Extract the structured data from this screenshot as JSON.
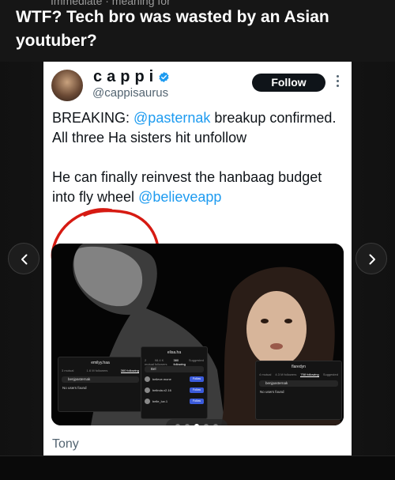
{
  "post": {
    "cut_text": "Immediate · meaning for",
    "title": "WTF? Tech bro was wasted by an Asian youtuber?"
  },
  "tweet": {
    "display_name": "cappi",
    "handle": "@cappisaurus",
    "follow_label": "Follow",
    "para1_before": "BREAKING: ",
    "para1_mention": "@pasternak",
    "para1_after": " breakup confirmed. All three Ha sisters hit unfollow",
    "para2_before": "He can finally reinvest the hanbaag budget into fly wheel ",
    "para2_mention": "@believeapp",
    "caption": "Tony",
    "accent_color": "#1d9bf0"
  },
  "media": {
    "screenshots": [
      {
        "header": "emilyy.haa",
        "tabs": [
          "3 mutual",
          "1.6 M followers",
          "360 following"
        ],
        "active_tab": "360 following",
        "search_value": "benjpasternak",
        "empty_text": "No users found"
      },
      {
        "header": "elisa.ha",
        "tabs": [
          "2 mutual",
          "98.4 K followers",
          "380 following",
          "Suggested"
        ],
        "active_tab": "380 following",
        "search_value": "Bel",
        "rows": [
          {
            "name": "believe.mone",
            "button": "Follow"
          },
          {
            "name": "belinda.v2.16",
            "button": "Follow"
          },
          {
            "name": "belle_lux.1",
            "button": "Follow"
          }
        ]
      },
      {
        "header": "flaredyn",
        "tabs": [
          "4 mutual",
          "4.3 M followers",
          "758 following",
          "Suggested"
        ],
        "active_tab": "758 following",
        "search_value": "benjpasternak",
        "empty_text": "No users found"
      }
    ],
    "carousel": {
      "count": 5,
      "active_index": 2
    }
  },
  "icons": {
    "verified": "verified-badge-icon",
    "more": "more-vertical-icon",
    "prev": "chevron-left-icon",
    "next": "chevron-right-icon"
  },
  "colors": {
    "annotation": "#d61a12",
    "follow_button": "#0f1419"
  }
}
